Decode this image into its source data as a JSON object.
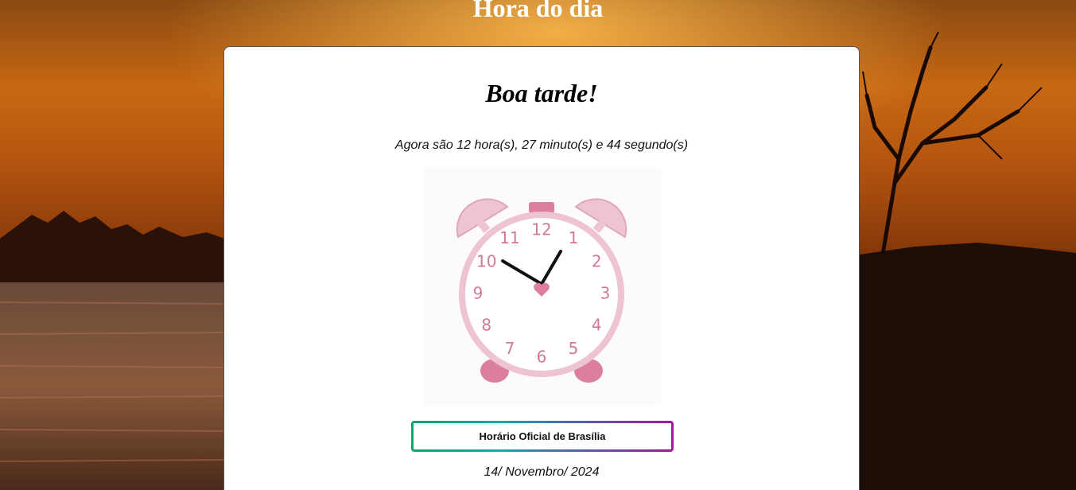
{
  "header": {
    "title": "Hora do dia"
  },
  "card": {
    "greeting": "Boa tarde!",
    "time_text": "Agora são 12 hora(s), 27 minuto(s) e 44 segundo(s)",
    "clock_numbers": [
      "12",
      "1",
      "2",
      "3",
      "4",
      "5",
      "6",
      "7",
      "8",
      "9",
      "10",
      "11"
    ],
    "button_label": "Horário Oficial de Brasília",
    "date_text": "14/ Novembro/ 2024"
  },
  "colors": {
    "clock_pink": "#dc7f9c",
    "clock_light_pink": "#eec3d3",
    "button_gradient": [
      "#13a36a",
      "#1aa8a8",
      "#5a5ab0",
      "#a0189a"
    ]
  }
}
